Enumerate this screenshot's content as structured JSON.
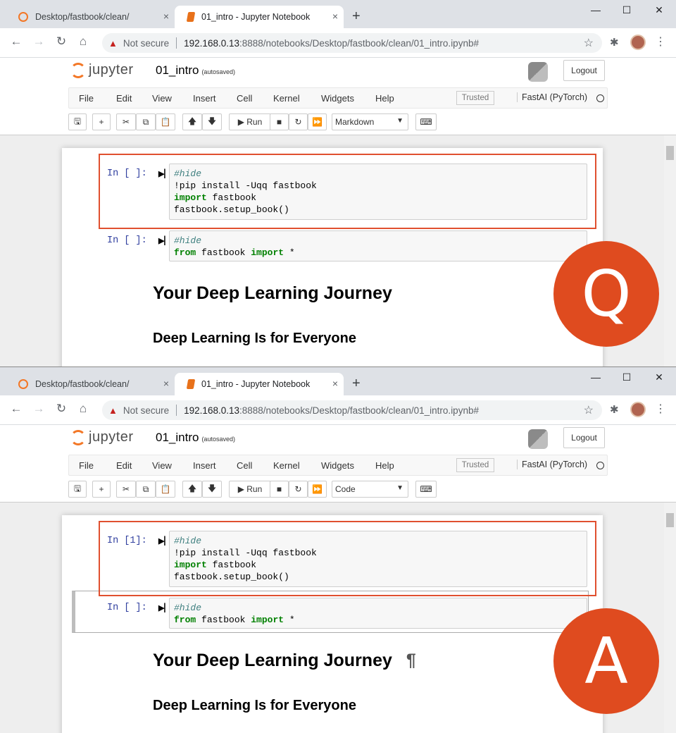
{
  "panels": [
    {
      "tabs": [
        {
          "label": "Desktop/fastbook/clean/",
          "close": "×"
        },
        {
          "label": "01_intro - Jupyter Notebook",
          "close": "×"
        }
      ],
      "new_tab": "+",
      "window_controls": {
        "minimize": "—",
        "maximize": "☐",
        "close": "✕"
      },
      "address": {
        "security_label": "Not secure",
        "host": "192.168.0.13",
        "path": ":8888/notebooks/Desktop/fastbook/clean/01_intro.ipynb#"
      },
      "jupyter": {
        "logo_text": "jupyter",
        "notebook_name": "01_intro",
        "autosaved": "(autosaved)",
        "logout": "Logout"
      },
      "menus": [
        "File",
        "Edit",
        "View",
        "Insert",
        "Cell",
        "Kernel",
        "Widgets",
        "Help"
      ],
      "trusted": "Trusted",
      "kernel_name": "FastAI (PyTorch)",
      "run_label": "Run",
      "cell_type": "Markdown",
      "cells": [
        {
          "prompt": "In [ ]:",
          "lines": [
            {
              "parts": [
                {
                  "t": "#hide",
                  "c": "comment"
                }
              ]
            },
            {
              "parts": [
                {
                  "t": "!pip install -Uqq fastbook",
                  "c": ""
                }
              ]
            },
            {
              "parts": [
                {
                  "t": "import",
                  "c": "kw"
                },
                {
                  "t": " fastbook",
                  "c": ""
                }
              ]
            },
            {
              "parts": [
                {
                  "t": "fastbook.setup_book()",
                  "c": ""
                }
              ]
            }
          ]
        },
        {
          "prompt": "In [ ]:",
          "lines": [
            {
              "parts": [
                {
                  "t": "#hide",
                  "c": "comment"
                }
              ]
            },
            {
              "parts": [
                {
                  "t": "from",
                  "c": "kw"
                },
                {
                  "t": " fastbook ",
                  "c": ""
                },
                {
                  "t": "import",
                  "c": "kw"
                },
                {
                  "t": " *",
                  "c": ""
                }
              ]
            }
          ]
        }
      ],
      "heading1": "Your Deep Learning Journey",
      "heading1_suffix": "",
      "heading2": "Deep Learning Is for Everyone",
      "badge": "Q",
      "badge_color": "#df4b1f",
      "highlight_color": "#e0502f"
    },
    {
      "tabs": [
        {
          "label": "Desktop/fastbook/clean/",
          "close": "×"
        },
        {
          "label": "01_intro - Jupyter Notebook",
          "close": "×"
        }
      ],
      "new_tab": "+",
      "window_controls": {
        "minimize": "—",
        "maximize": "☐",
        "close": "✕"
      },
      "address": {
        "security_label": "Not secure",
        "host": "192.168.0.13",
        "path": ":8888/notebooks/Desktop/fastbook/clean/01_intro.ipynb#"
      },
      "jupyter": {
        "logo_text": "jupyter",
        "notebook_name": "01_intro",
        "autosaved": "(autosaved)",
        "logout": "Logout"
      },
      "menus": [
        "File",
        "Edit",
        "View",
        "Insert",
        "Cell",
        "Kernel",
        "Widgets",
        "Help"
      ],
      "trusted": "Trusted",
      "kernel_name": "FastAI (PyTorch)",
      "run_label": "Run",
      "cell_type": "Code",
      "cells": [
        {
          "prompt": "In [1]:",
          "lines": [
            {
              "parts": [
                {
                  "t": "#hide",
                  "c": "comment"
                }
              ]
            },
            {
              "parts": [
                {
                  "t": "!pip install -Uqq fastbook",
                  "c": ""
                }
              ]
            },
            {
              "parts": [
                {
                  "t": "import",
                  "c": "kw"
                },
                {
                  "t": " fastbook",
                  "c": ""
                }
              ]
            },
            {
              "parts": [
                {
                  "t": "fastbook.setup_book()",
                  "c": ""
                }
              ]
            }
          ]
        },
        {
          "prompt": "In [ ]:",
          "selected": true,
          "lines": [
            {
              "parts": [
                {
                  "t": "#hide",
                  "c": "comment"
                }
              ]
            },
            {
              "parts": [
                {
                  "t": "from",
                  "c": "kw"
                },
                {
                  "t": " fastbook ",
                  "c": ""
                },
                {
                  "t": "import",
                  "c": "kw"
                },
                {
                  "t": " *",
                  "c": ""
                }
              ]
            }
          ]
        }
      ],
      "heading1": "Your Deep Learning Journey",
      "heading1_suffix": "¶",
      "heading2": "Deep Learning Is for Everyone",
      "badge": "A",
      "badge_color": "#df4b1f",
      "highlight_color": "#e0502f"
    }
  ]
}
